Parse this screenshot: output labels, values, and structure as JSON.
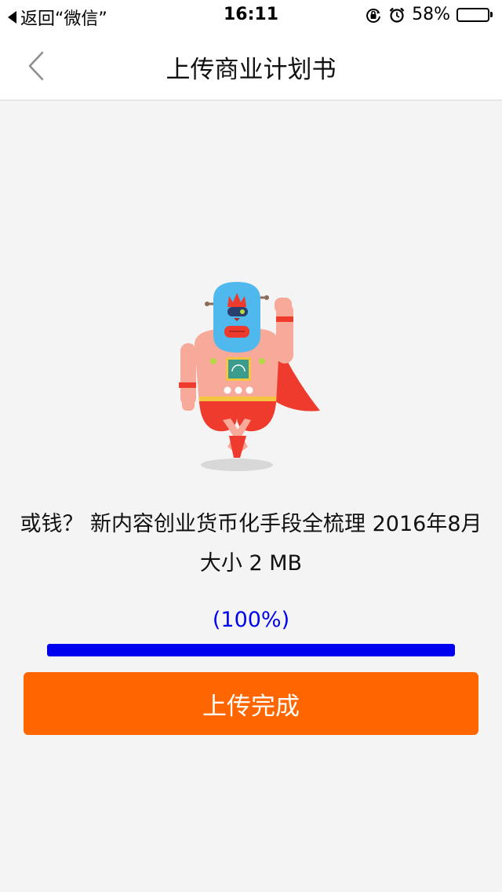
{
  "status_bar": {
    "back_label": "返回“微信”",
    "time": "16:11",
    "battery_percent_label": "58%",
    "battery_level": 0.58,
    "icons": [
      "orientation-lock-icon",
      "alarm-icon",
      "battery-icon"
    ]
  },
  "nav": {
    "title": "上传商业计划书",
    "back_icon": "chevron-left-icon"
  },
  "file": {
    "name": "或钱？ 新内容创业货币化手段全梳理 2016年8月",
    "size_label": "大小 2 MB"
  },
  "progress": {
    "percent_label": "(100%)",
    "value": 1.0
  },
  "button": {
    "label": "上传完成"
  },
  "colors": {
    "accent": "#ff6600",
    "progress": "#0000ee",
    "background": "#f4f4f4"
  }
}
